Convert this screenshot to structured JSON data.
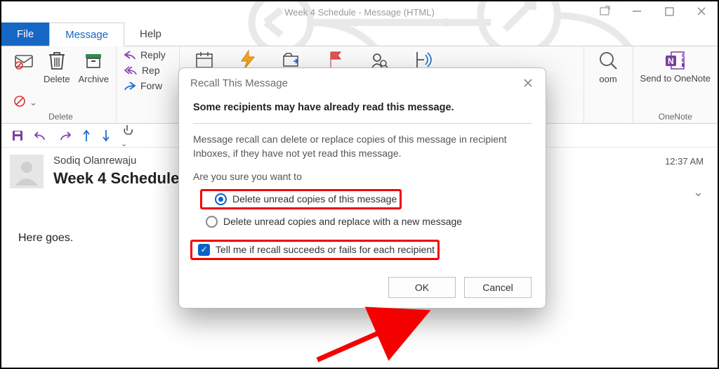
{
  "window": {
    "title": "Week 4 Schedule  -  Message (HTML)"
  },
  "tabs": {
    "file": "File",
    "message": "Message",
    "help": "Help"
  },
  "ribbon": {
    "delete_group": "Delete",
    "delete": "Delete",
    "archive": "Archive",
    "reply": "Reply",
    "reply_prefix": "Rep",
    "forward_prefix": "Forw",
    "zoom_suffix": "oom",
    "onenote": "Send to OneNote",
    "onenote_group": "OneNote"
  },
  "message": {
    "sender": "Sodiq Olanrewaju",
    "subject": "Week 4 Schedule",
    "timestamp": "12:37 AM",
    "body": "Here goes."
  },
  "dialog": {
    "title": "Recall This Message",
    "headline": "Some recipients may have already read this message.",
    "desc": "Message recall can delete or replace copies of this message in recipient Inboxes, if they have not yet read this message.",
    "question": "Are you sure you want to",
    "opt_delete": "Delete unread copies of this message",
    "opt_replace": "Delete unread copies and replace with a new message",
    "opt_notify": "Tell me if recall succeeds or fails for each recipient",
    "ok": "OK",
    "cancel": "Cancel"
  }
}
